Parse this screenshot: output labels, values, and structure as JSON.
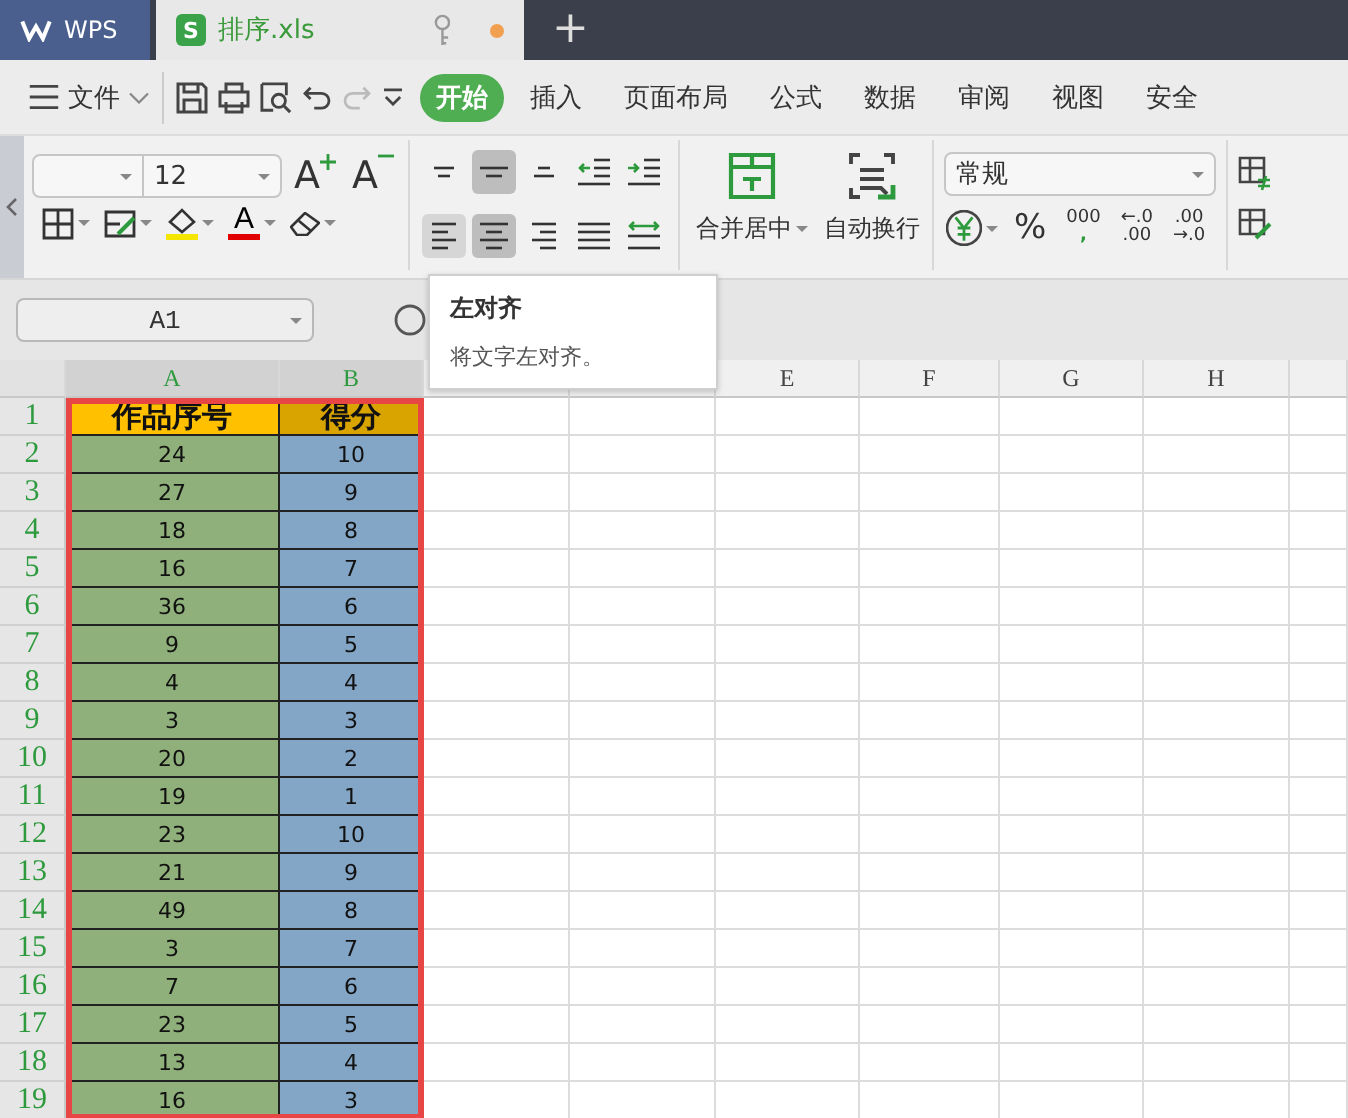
{
  "title_tabs": [
    {
      "kind": "app",
      "label": "WPS",
      "selected": false
    },
    {
      "kind": "file",
      "label": "排序.xls",
      "icon_text": "S",
      "selected": true,
      "modified": true
    }
  ],
  "new_tab": "+",
  "menu": {
    "file": "文件",
    "redo_disabled": true,
    "tabs": [
      {
        "label": "开始",
        "selected": true
      },
      {
        "label": "插入",
        "selected": false
      },
      {
        "label": "页面布局",
        "selected": false
      },
      {
        "label": "公式",
        "selected": false
      },
      {
        "label": "数据",
        "selected": false
      },
      {
        "label": "审阅",
        "selected": false
      },
      {
        "label": "视图",
        "selected": false
      },
      {
        "label": "安全",
        "selected": false
      }
    ]
  },
  "ribbon": {
    "font_size": "12",
    "grow_font": "A",
    "shrink_font": "A",
    "fill_color": {
      "color": "#f5e600"
    },
    "font_color": {
      "label": "A",
      "color": "#e00000"
    },
    "align_buttons": [
      {
        "kind": "top",
        "selected": false,
        "hovered": false
      },
      {
        "kind": "middle",
        "selected": true,
        "hovered": false
      },
      {
        "kind": "bottom",
        "selected": false,
        "hovered": false
      },
      {
        "kind": "outdent",
        "selected": false,
        "hovered": false
      },
      {
        "kind": "indent",
        "selected": false,
        "hovered": false
      },
      {
        "kind": "left",
        "selected": false,
        "hovered": true
      },
      {
        "kind": "center",
        "selected": true,
        "hovered": false
      },
      {
        "kind": "right",
        "selected": false,
        "hovered": false
      },
      {
        "kind": "justify",
        "selected": false,
        "hovered": false
      },
      {
        "kind": "distribute",
        "selected": false,
        "hovered": false
      }
    ],
    "merge": "合并居中",
    "wrap": "自动换行",
    "number_format": "常规",
    "number_buttons": [
      {
        "kind": "percent",
        "lines": [
          "%"
        ]
      },
      {
        "kind": "thousands",
        "lines": [
          "000",
          ","
        ]
      },
      {
        "kind": "increase-decimal",
        "lines": [
          "←.0",
          ".00"
        ]
      },
      {
        "kind": "decrease-decimal",
        "lines": [
          ".00",
          "→.0"
        ]
      }
    ]
  },
  "name_box": "A1",
  "tooltip": {
    "title": "左对齐",
    "text": "将文字左对齐。"
  },
  "sheet": {
    "columns": [
      {
        "label": "A",
        "selected": true,
        "color": "#8fb07a"
      },
      {
        "label": "B",
        "selected": true,
        "color": "#84a6c6"
      },
      {
        "selected": false
      },
      {
        "selected": false
      },
      {
        "label": "E",
        "selected": false
      },
      {
        "label": "F",
        "selected": false
      },
      {
        "label": "G",
        "selected": false
      },
      {
        "label": "H",
        "selected": false
      }
    ],
    "rows": [
      {
        "num": "1",
        "cells": [
          "作品序号",
          "得分"
        ]
      },
      {
        "num": "2",
        "cells": [
          "24",
          "10"
        ]
      },
      {
        "num": "3",
        "cells": [
          "27",
          "9"
        ]
      },
      {
        "num": "4",
        "cells": [
          "18",
          "8"
        ]
      },
      {
        "num": "5",
        "cells": [
          "16",
          "7"
        ]
      },
      {
        "num": "6",
        "cells": [
          "36",
          "6"
        ]
      },
      {
        "num": "7",
        "cells": [
          "9",
          "5"
        ]
      },
      {
        "num": "8",
        "cells": [
          "4",
          "4"
        ]
      },
      {
        "num": "9",
        "cells": [
          "3",
          "3"
        ]
      },
      {
        "num": "10",
        "cells": [
          "20",
          "2"
        ]
      },
      {
        "num": "11",
        "cells": [
          "19",
          "1"
        ]
      },
      {
        "num": "12",
        "cells": [
          "23",
          "10"
        ]
      },
      {
        "num": "13",
        "cells": [
          "21",
          "9"
        ]
      },
      {
        "num": "14",
        "cells": [
          "49",
          "8"
        ]
      },
      {
        "num": "15",
        "cells": [
          "3",
          "7"
        ]
      },
      {
        "num": "16",
        "cells": [
          "7",
          "6"
        ]
      },
      {
        "num": "17",
        "cells": [
          "23",
          "5"
        ]
      },
      {
        "num": "18",
        "cells": [
          "13",
          "4"
        ]
      },
      {
        "num": "19",
        "cells": [
          "16",
          "3"
        ]
      }
    ]
  }
}
